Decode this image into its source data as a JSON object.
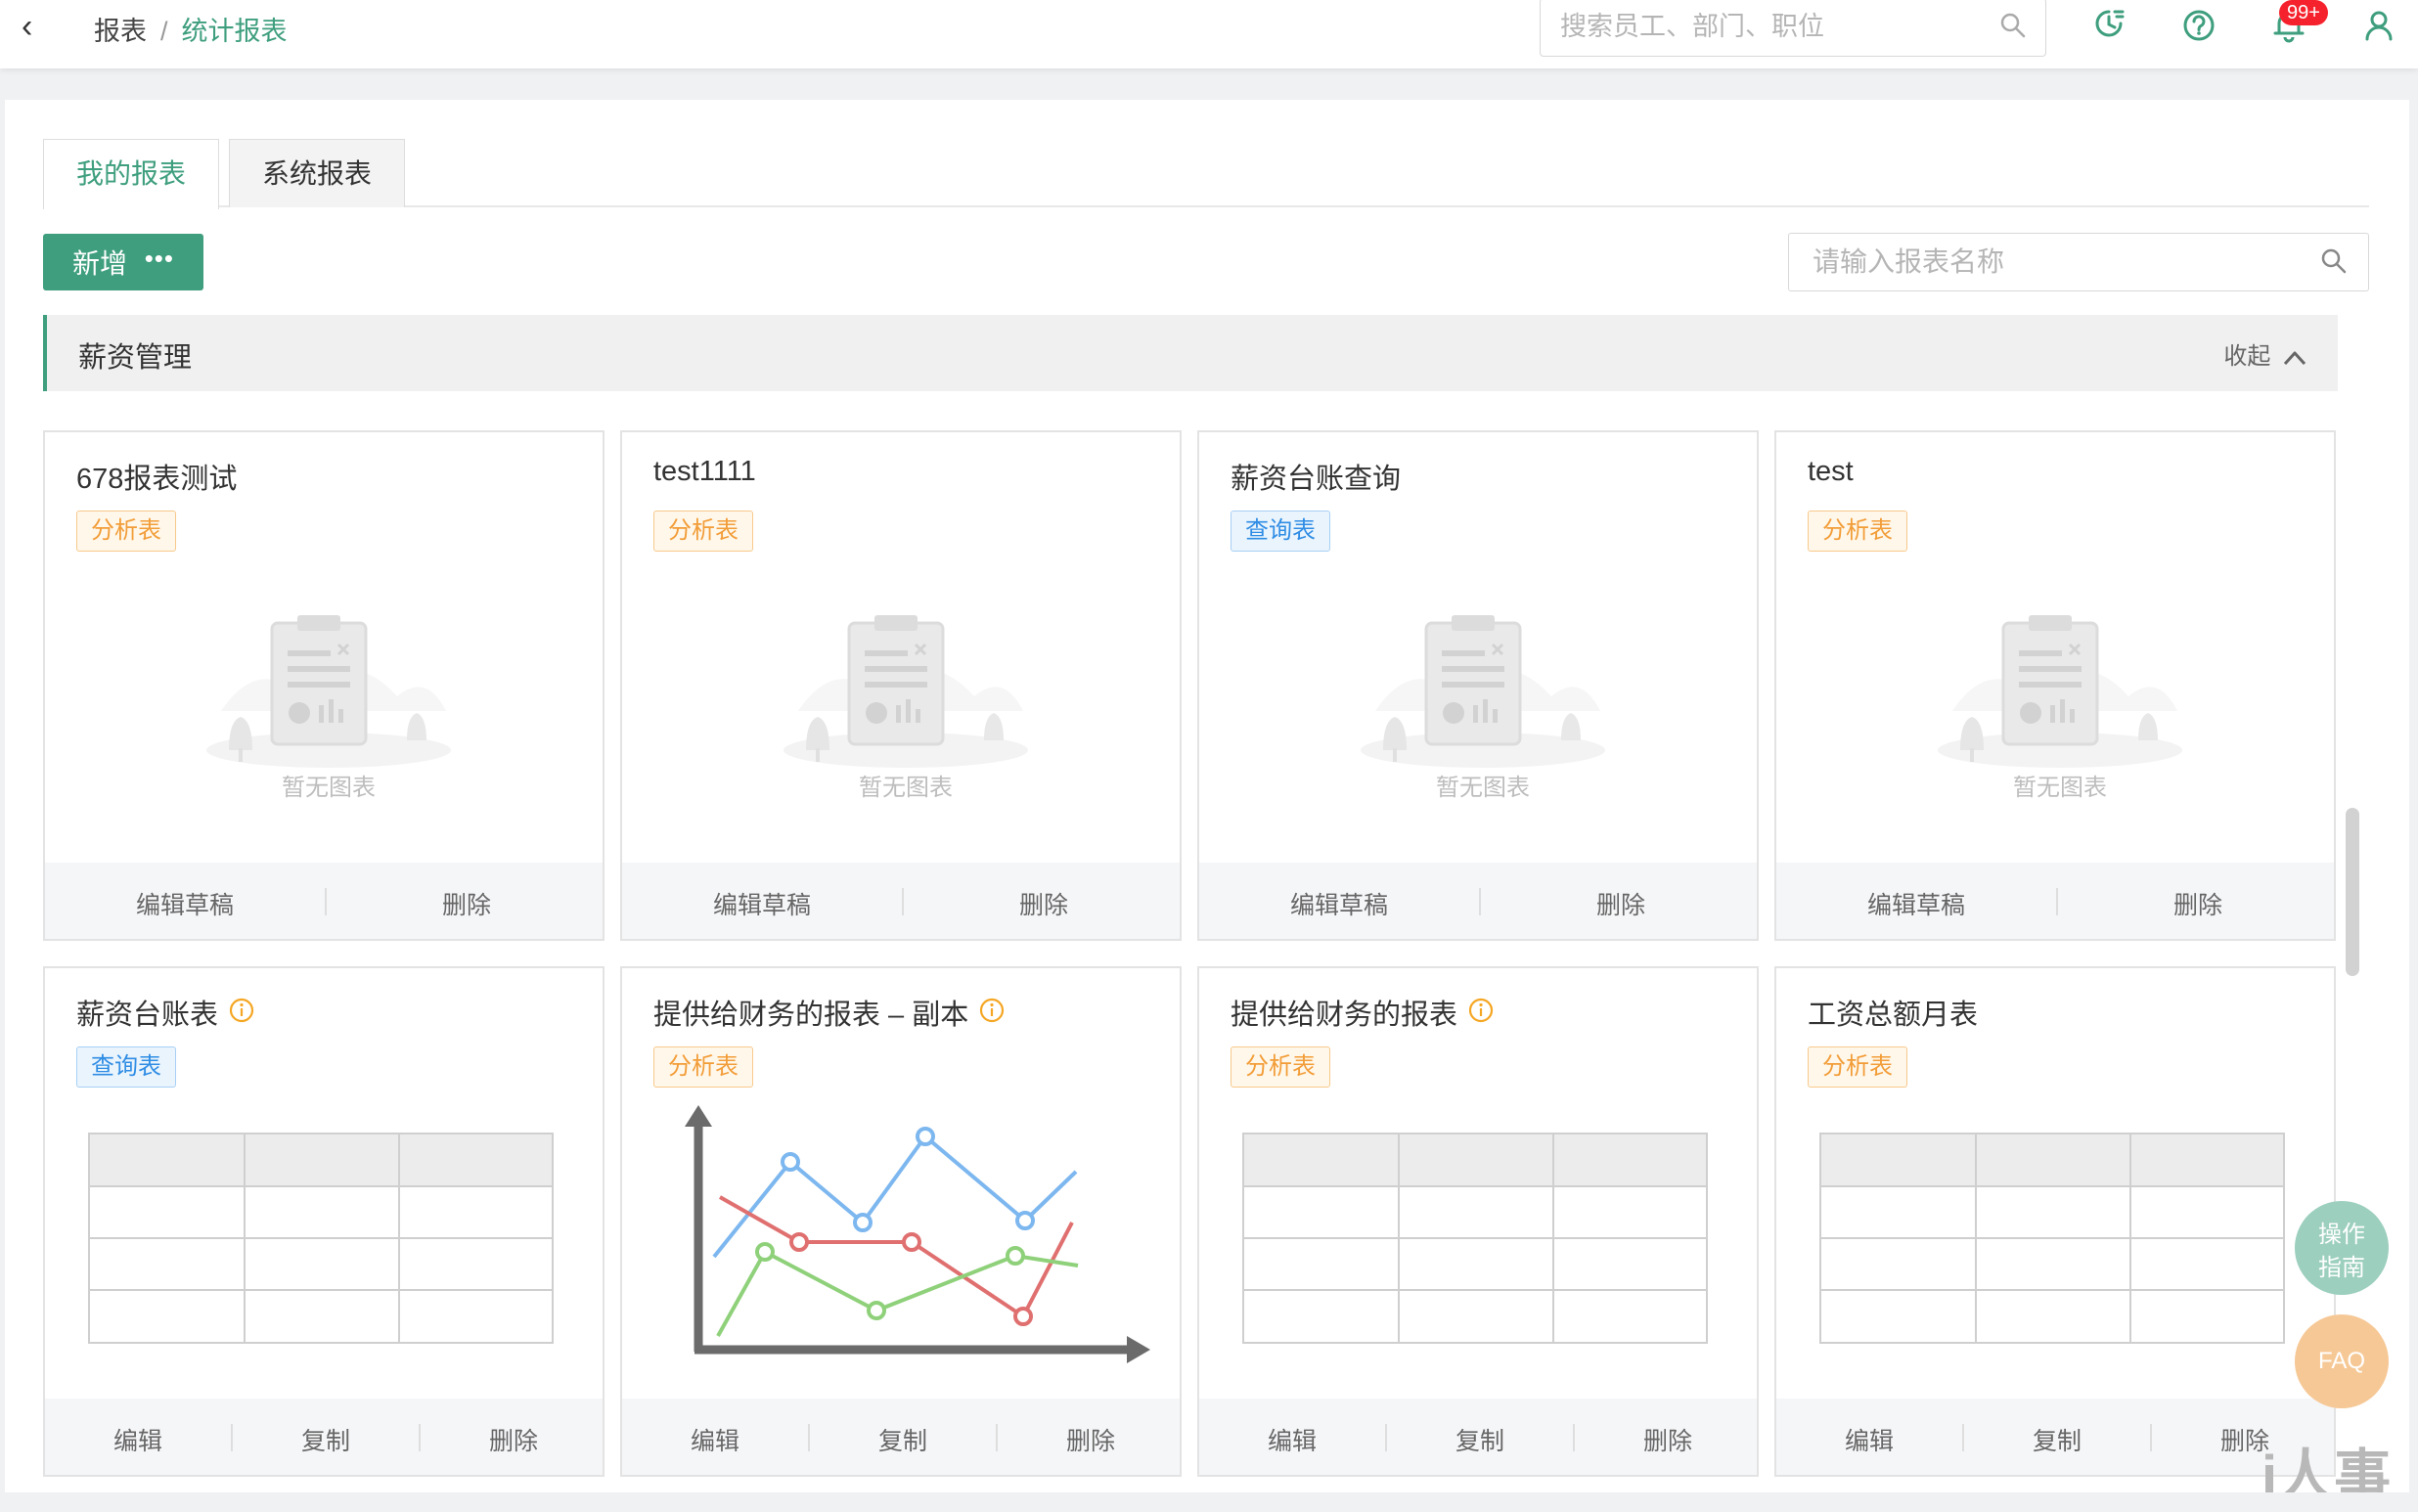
{
  "header": {
    "back_icon": "chevron-left-icon",
    "breadcrumb": [
      "报表",
      "统计报表"
    ],
    "separator": "/",
    "search_placeholder": "搜索员工、部门、职位",
    "icons": [
      "history-icon",
      "help-icon",
      "bell-icon",
      "user-icon"
    ],
    "notification_count": "99+"
  },
  "tabs": [
    {
      "label": "我的报表",
      "active": true
    },
    {
      "label": "系统报表",
      "active": false
    }
  ],
  "toolbar": {
    "add_label": "新增",
    "more_icon": "ellipsis-icon",
    "search_placeholder": "请输入报表名称"
  },
  "group": {
    "title": "薪资管理",
    "collapse_label": "收起"
  },
  "cards": [
    {
      "title": "678报表测试",
      "tag": "分析表",
      "tag_type": "analysis",
      "preview": "empty",
      "empty_text": "暂无图表",
      "info": false,
      "actions": [
        "编辑草稿",
        "删除"
      ]
    },
    {
      "title": "test1111",
      "tag": "分析表",
      "tag_type": "analysis",
      "preview": "empty",
      "empty_text": "暂无图表",
      "info": false,
      "actions": [
        "编辑草稿",
        "删除"
      ]
    },
    {
      "title": "薪资台账查询",
      "tag": "查询表",
      "tag_type": "query",
      "preview": "empty",
      "empty_text": "暂无图表",
      "info": false,
      "actions": [
        "编辑草稿",
        "删除"
      ]
    },
    {
      "title": "test",
      "tag": "分析表",
      "tag_type": "analysis",
      "preview": "empty",
      "empty_text": "暂无图表",
      "info": false,
      "actions": [
        "编辑草稿",
        "删除"
      ]
    },
    {
      "title": "薪资台账表",
      "tag": "查询表",
      "tag_type": "query",
      "preview": "table",
      "info": true,
      "actions": [
        "编辑",
        "复制",
        "删除"
      ]
    },
    {
      "title": "提供给财务的报表 – 副本",
      "tag": "分析表",
      "tag_type": "analysis",
      "preview": "line",
      "info": true,
      "actions": [
        "编辑",
        "复制",
        "删除"
      ]
    },
    {
      "title": "提供给财务的报表",
      "tag": "分析表",
      "tag_type": "analysis",
      "preview": "table",
      "info": true,
      "actions": [
        "编辑",
        "复制",
        "删除"
      ]
    },
    {
      "title": "工资总额月表",
      "tag": "分析表",
      "tag_type": "analysis",
      "preview": "table",
      "info": false,
      "actions": [
        "编辑",
        "复制",
        "删除"
      ]
    }
  ],
  "float_buttons": {
    "guide_line1": "操作",
    "guide_line2": "指南",
    "faq": "FAQ"
  },
  "watermark": "i人事",
  "colors": {
    "primary": "#3e9e7e",
    "analysis_tag": "#f29d38",
    "query_tag": "#2f8de4",
    "badge": "#f5222d"
  }
}
